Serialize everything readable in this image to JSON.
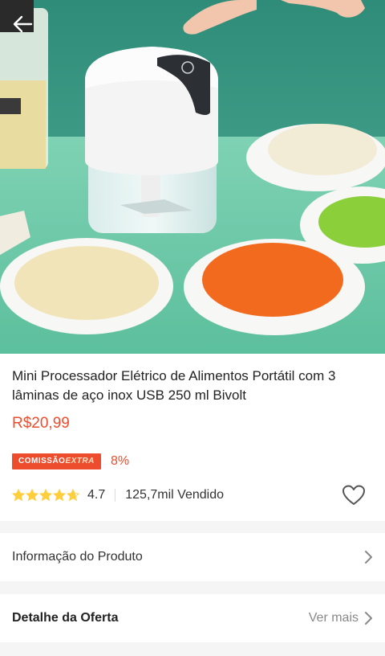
{
  "product": {
    "title": "Mini Processador Elétrico de Alimentos Portátil com 3 lâminas de aço inox USB 250 ml Bivolt",
    "price": "R$20,99",
    "commission_badge_prefix": "COMISSÃO",
    "commission_badge_suffix": "EXTRA",
    "commission_percent": "8%",
    "rating": "4.7",
    "rating_stars": 4.7,
    "sold": "125,7mil Vendido"
  },
  "rows": {
    "product_info_label": "Informação do Produto",
    "offer_detail_label": "Detalhe da Oferta",
    "offer_detail_link": "Ver mais"
  },
  "colors": {
    "accent": "#ee4d2d",
    "star": "#ffce3d"
  },
  "icons": [
    "back-arrow-icon",
    "star-icon",
    "heart-icon",
    "chevron-right-icon"
  ]
}
